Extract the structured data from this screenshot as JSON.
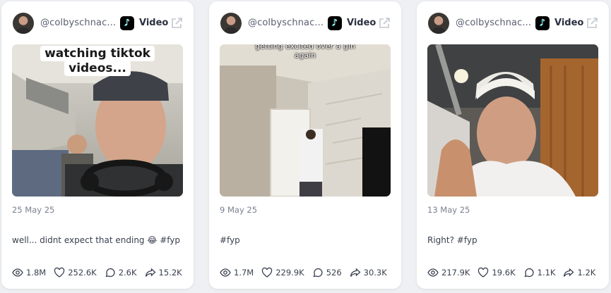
{
  "cards": [
    {
      "handle": "@colbyschnac...",
      "platform_icon": "tiktok-icon",
      "type_label": "Video",
      "overlay_caption_line1": "watching tiktok",
      "overlay_caption_line2": "videos...",
      "date": "25 May 25",
      "description": "well... didnt expect that ending 😂 #fyp",
      "stats": {
        "views": "1.8M",
        "likes": "252.6K",
        "comments": "2.6K",
        "shares": "15.2K"
      }
    },
    {
      "handle": "@colbyschnac...",
      "platform_icon": "tiktok-icon",
      "type_label": "Video",
      "overlay_caption_line1": "getting excited over a gin",
      "overlay_caption_line2": "again",
      "date": "9 May 25",
      "description": "#fyp",
      "stats": {
        "views": "1.7M",
        "likes": "229.9K",
        "comments": "526",
        "shares": "30.3K"
      }
    },
    {
      "handle": "@colbyschnac...",
      "platform_icon": "tiktok-icon",
      "type_label": "Video",
      "date": "13 May 25",
      "description": "Right? #fyp",
      "stats": {
        "views": "217.9K",
        "likes": "19.6K",
        "comments": "1.1K",
        "shares": "1.2K"
      }
    }
  ]
}
